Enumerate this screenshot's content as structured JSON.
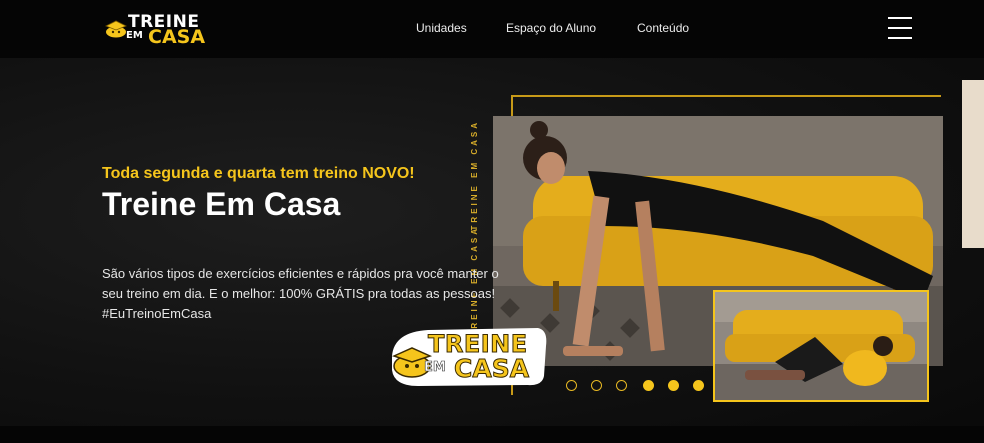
{
  "brand": {
    "line1": "TREINE",
    "line2_small": "EM",
    "line2_big": "CASA",
    "accent_color": "#f5c51c"
  },
  "nav": {
    "items": [
      "Unidades",
      "Espaço do Aluno",
      "Conteúdo"
    ]
  },
  "menu_icon": "hamburger-icon",
  "hero": {
    "tagline": "Toda segunda e quarta tem treino NOVO!",
    "title": "Treine Em Casa",
    "description": "São vários tipos de exercícios eficientes e rápidos pra você manter o seu treino em dia. E o melhor: 100% GRÁTIS pra todas as pessoas! #EuTreinoEmCasa",
    "vertical_text": "TREINE EM CASA"
  },
  "carousel": {
    "slides": 6,
    "active": [
      4,
      5,
      6
    ]
  }
}
